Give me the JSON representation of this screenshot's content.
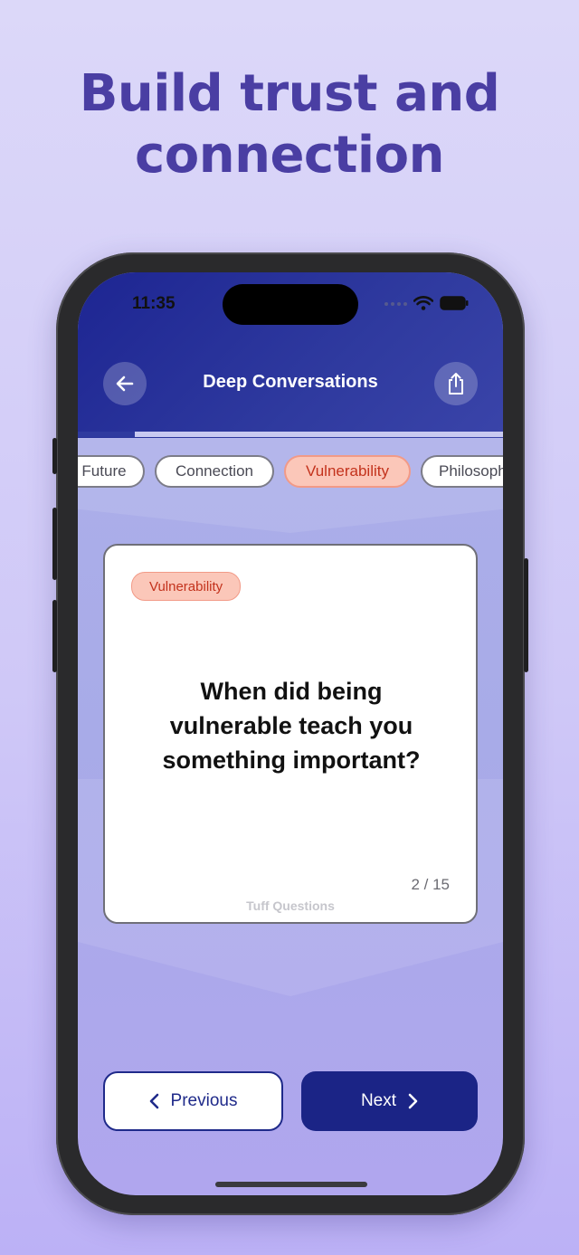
{
  "headline": {
    "line1": "Build trust and",
    "line2": "connection"
  },
  "status_bar": {
    "time": "11:35"
  },
  "nav": {
    "title": "Deep Conversations",
    "back_icon": "arrow-left-icon",
    "share_icon": "share-icon"
  },
  "progress": {
    "fraction": 0.133
  },
  "chips": [
    {
      "label": "Future",
      "active": false
    },
    {
      "label": "Connection",
      "active": false
    },
    {
      "label": "Vulnerability",
      "active": true
    },
    {
      "label": "Philosophy",
      "active": false
    }
  ],
  "card": {
    "tag": "Vulnerability",
    "question": "When did being vulnerable teach you something important?",
    "counter": "2 / 15",
    "brand": "Tuff Questions"
  },
  "buttons": {
    "previous": "Previous",
    "next": "Next"
  },
  "colors": {
    "headline": "#4a3ea3",
    "header": "#1d2592",
    "accent": "#c3321c",
    "chip_active_bg": "#fbc7b9",
    "primary_button": "#1b2486"
  }
}
